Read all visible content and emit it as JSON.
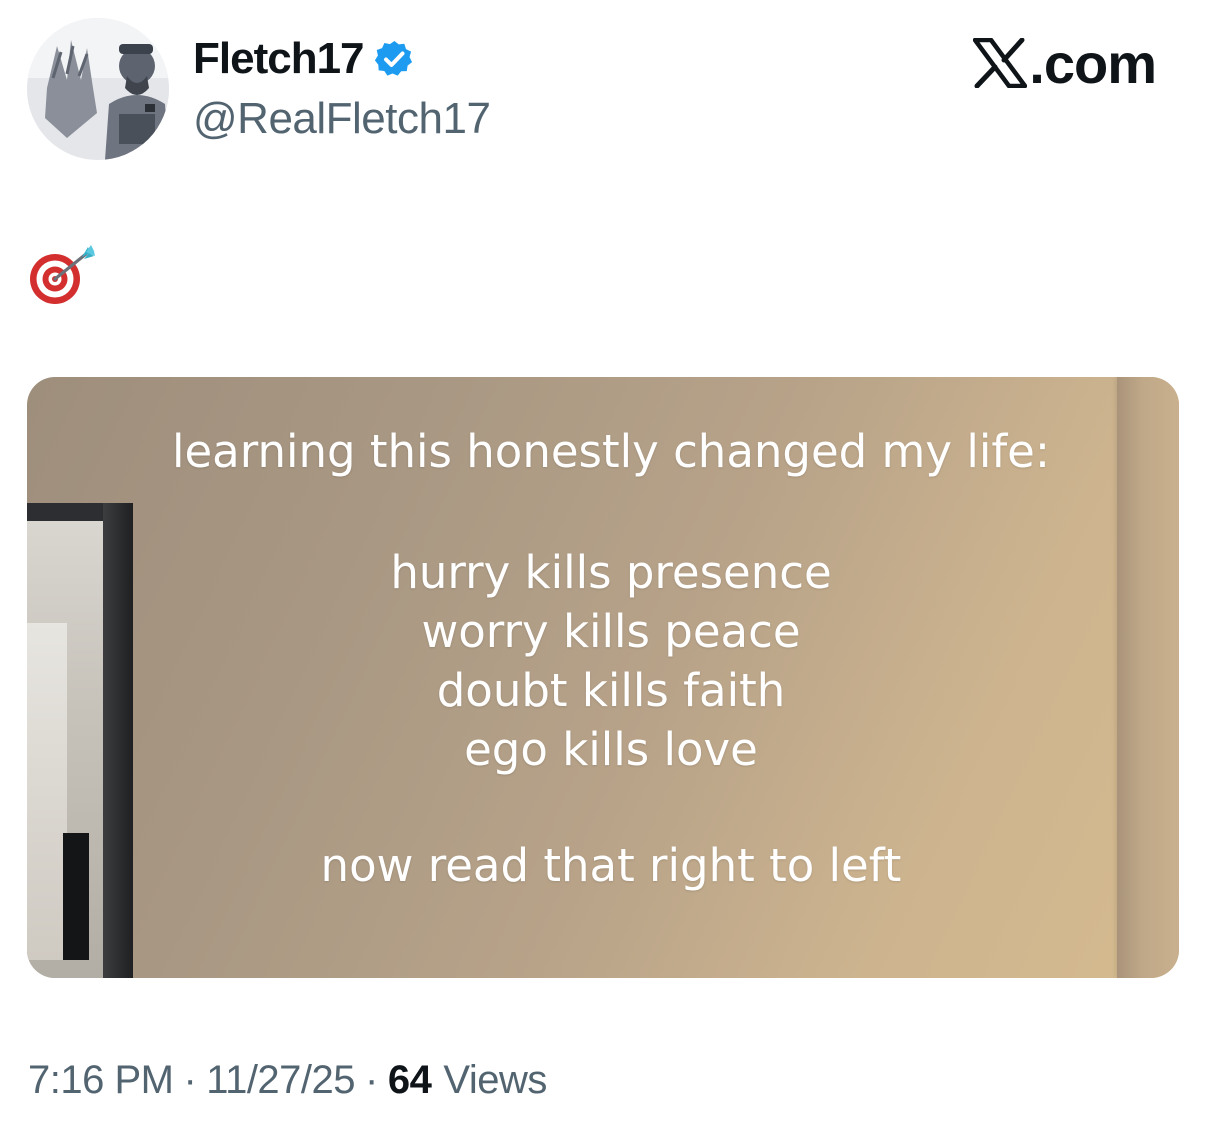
{
  "author": {
    "display_name": "Fletch17",
    "handle": "@RealFletch17",
    "verified": true,
    "verified_color": "#1d9bf0",
    "avatar_icon": "profile-photo"
  },
  "brand": {
    "icon": "x-logo-icon",
    "suffix": ".com"
  },
  "tweet": {
    "text_icon": "direct-hit-emoji"
  },
  "media": {
    "headline": "learning this honestly changed my life:",
    "lines": [
      "hurry kills presence",
      "worry kills peace",
      "doubt kills faith",
      "ego kills love"
    ],
    "footer": "now read that right to left"
  },
  "meta": {
    "time": "7:16 PM",
    "separator": "·",
    "date": "11/27/25",
    "views_count": "64",
    "views_label": "Views"
  },
  "colors": {
    "text_primary": "#0f1419",
    "text_secondary": "#536471",
    "verified": "#1d9bf0"
  }
}
